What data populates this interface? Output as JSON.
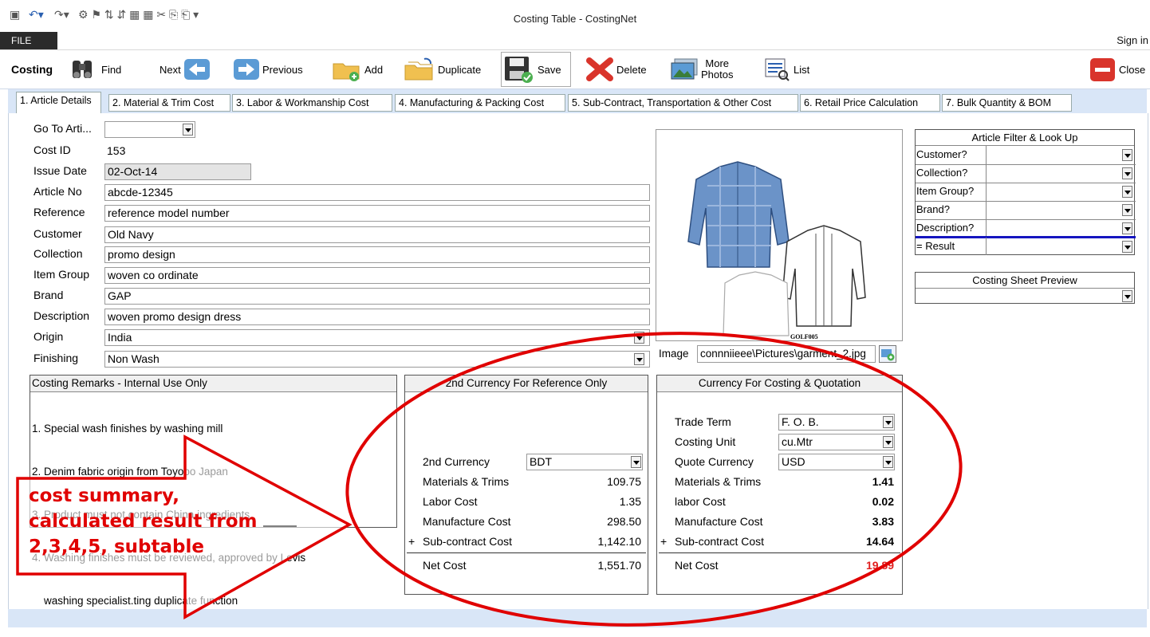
{
  "window": {
    "title": "Costing Table - CostingNet"
  },
  "ribbon": {
    "file_tab": "FILE",
    "sign_in": "Sign in"
  },
  "toolbar": {
    "section_label": "Costing",
    "find": "Find",
    "next": "Next",
    "previous": "Previous",
    "add": "Add",
    "duplicate": "Duplicate",
    "save": "Save",
    "delete": "Delete",
    "more_photos_1": "More",
    "more_photos_2": "Photos",
    "list": "List",
    "close": "Close"
  },
  "tabs": [
    "1. Article Details",
    "2. Material & Trim Cost",
    "3. Labor & Workmanship Cost",
    "4. Manufacturing & Packing Cost",
    "5. Sub-Contract, Transportation & Other Cost",
    "6. Retail Price Calculation",
    "7. Bulk Quantity & BOM"
  ],
  "article": {
    "goto_label": "Go To Arti...",
    "goto_value": "",
    "cost_id_label": "Cost ID",
    "cost_id": "153",
    "issue_date_label": "Issue Date",
    "issue_date": "02-Oct-14",
    "article_no_label": "Article No",
    "article_no": "abcde-12345",
    "reference_label": "Reference",
    "reference": "reference model number",
    "customer_label": "Customer",
    "customer": "Old Navy",
    "collection_label": "Collection",
    "collection": "promo design",
    "item_group_label": "Item Group",
    "item_group": "woven co ordinate",
    "brand_label": "Brand",
    "brand": "GAP",
    "description_label": "Description",
    "description": "woven promo design dress",
    "origin_label": "Origin",
    "origin": "India",
    "finishing_label": "Finishing",
    "finishing": "Non Wash"
  },
  "image": {
    "label": "Image",
    "path": "connniieee\\Pictures\\garment_2.jpg",
    "caption": "GOLF005"
  },
  "filter": {
    "title": "Article Filter & Look Up",
    "rows": [
      "Customer?",
      "Collection?",
      "Item Group?",
      "Brand?",
      "Description?"
    ],
    "result_label": "= Result"
  },
  "preview": {
    "title": "Costing Sheet Preview"
  },
  "remarks": {
    "title": "Costing Remarks - Internal Use Only",
    "lines": [
      "1. Special wash finishes by washing mill",
      "2. Denim fabric origin from Toyobo Japan",
      "3. Product must not contain China ingredients",
      "4. Washing finishes must be reviewed, approved by Levis",
      "    washing specialist.ting duplicate function"
    ]
  },
  "second_currency": {
    "title": "2nd Currency For Reference Only",
    "currency_label": "2nd Currency",
    "currency": "BDT",
    "materials_label": "Materials & Trims",
    "materials": "109.75",
    "labor_label": "Labor Cost",
    "labor": "1.35",
    "manufacture_label": "Manufacture Cost",
    "manufacture": "298.50",
    "plus": "+",
    "subcontract_label": "Sub-contract Cost",
    "subcontract": "1,142.10",
    "net_label": "Net Cost",
    "net": "1,551.70"
  },
  "costing_currency": {
    "title": "Currency For Costing & Quotation",
    "trade_term_label": "Trade Term",
    "trade_term": "F. O. B.",
    "costing_unit_label": "Costing Unit",
    "costing_unit": "cu.Mtr",
    "quote_currency_label": "Quote Currency",
    "quote_currency": "USD",
    "materials_label": "Materials & Trims",
    "materials": "1.41",
    "labor_label": "labor Cost",
    "labor": "0.02",
    "manufacture_label": "Manufacture Cost",
    "manufacture": "3.83",
    "plus": "+",
    "subcontract_label": "Sub-contract Cost",
    "subcontract": "14.64",
    "net_label": "Net Cost",
    "net": "19.89"
  },
  "annotation": {
    "line1": "cost summary,",
    "line2": "calculated result from",
    "line3": "2,3,4,5, subtable"
  },
  "colors": {
    "accent": "#e00000",
    "net_cost": "#e02020",
    "tab_strip": "#d9e6f7"
  }
}
